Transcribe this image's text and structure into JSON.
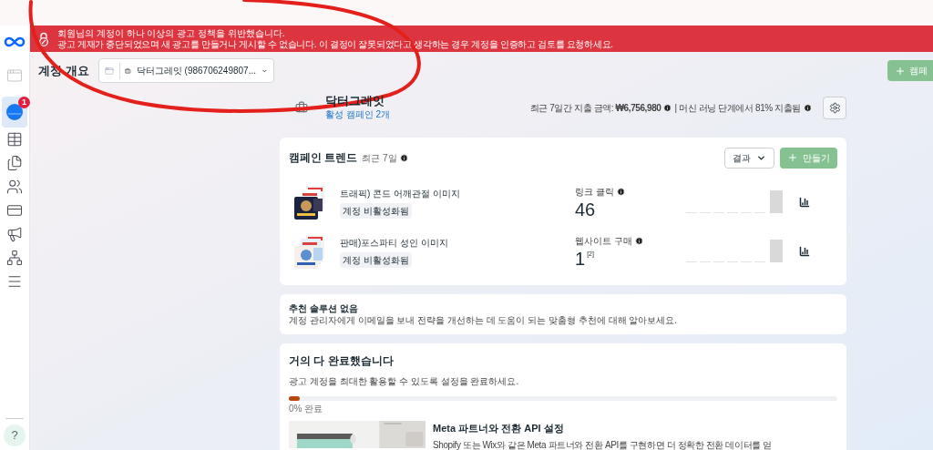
{
  "sidebar": {
    "items": [
      {
        "selected": false
      },
      {
        "selected": true,
        "badge": "1"
      },
      {
        "selected": false
      },
      {
        "selected": false
      },
      {
        "selected": false
      },
      {
        "selected": false
      },
      {
        "selected": false
      },
      {
        "selected": false
      },
      {
        "selected": false
      }
    ],
    "help": "?"
  },
  "banner": {
    "title": "회원님의 계정이 하나 이상의 광고 정책을 위반했습니다.",
    "message": "광고 게재가 중단되었으며 새 광고를 만들거나 게시할 수 없습니다. 이 결정이 잘못되었다고 생각하는 경우 계정을 인증하고 검토를 요청하세요."
  },
  "header": {
    "title": "계정 개요",
    "account_selector": "닥터그레잇 (986706249807...",
    "create_campaign": {
      "label": "캠페",
      "disabled": true
    }
  },
  "account": {
    "name": "닥터그레잇",
    "active_campaigns": "활성 캠페인 2개",
    "spend_label": "최근 7일간 지출 금액:",
    "spend_value": "₩6,756,980",
    "learning": "| 머신 러닝 단계에서 81% 지출됨"
  },
  "trend": {
    "title": "캠페인 트렌드",
    "period": "최근 7일",
    "dropdown": "결과",
    "create": {
      "label": "만들기",
      "disabled": true
    },
    "campaigns": [
      {
        "name": "트래픽) 콘드 어깨관절 이미지",
        "status": "계정 비활성화됨",
        "metric": "링크 클릭",
        "value": "46"
      },
      {
        "name": "판매)포스파티 성인 이미지",
        "status": "계정 비활성화됨",
        "metric": "웹사이트 구매",
        "value": "1",
        "footnote": "[2]"
      }
    ]
  },
  "recommendations": {
    "title": "추천 솔루션 없음",
    "body": "계정 관리자에게 이메일을 보내 전략을 개선하는 데 도움이 되는 맞춤형 추천에 대해 알아보세요."
  },
  "setup": {
    "title": "거의 다 완료했습니다",
    "body": "광고 계정을 최대한 활용할 수 있도록 설정을 완료하세요.",
    "level": 0.02,
    "progress_label": "0% 완료",
    "task_title": "Meta 파트너와 전환 API 설정",
    "task_body": "Shopify 또는 Wix와 같은 Meta 파트너와 전환 API를 구현하면 더 정확한 전환 데이터를 얻"
  }
}
